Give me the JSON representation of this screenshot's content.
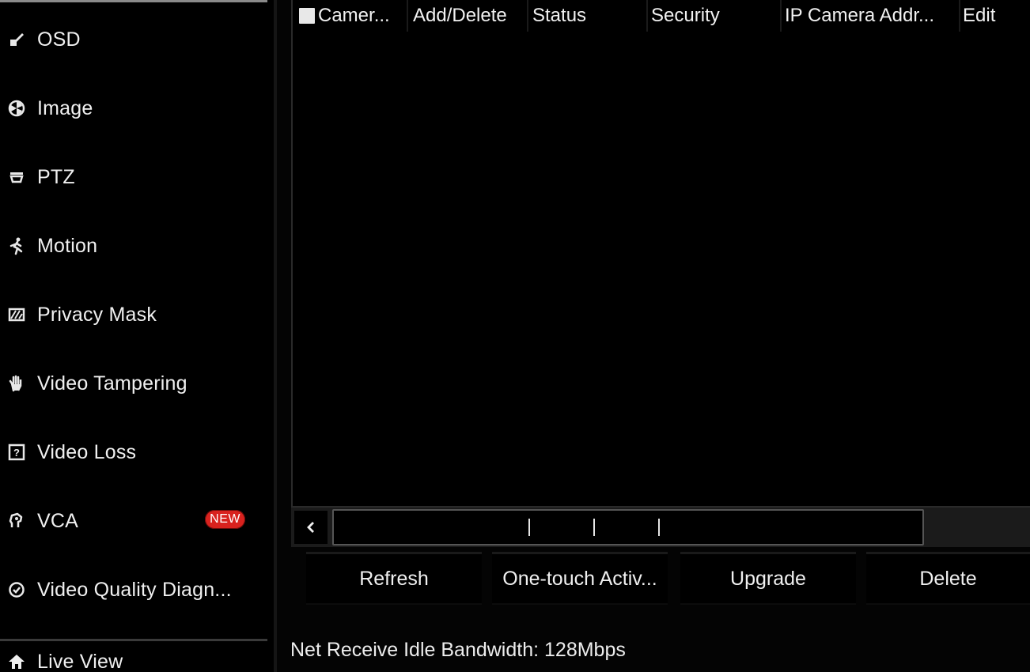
{
  "sidebar": {
    "items": [
      {
        "label": "OSD",
        "icon": "osd-icon"
      },
      {
        "label": "Image",
        "icon": "image-icon"
      },
      {
        "label": "PTZ",
        "icon": "ptz-icon"
      },
      {
        "label": "Motion",
        "icon": "motion-icon"
      },
      {
        "label": "Privacy Mask",
        "icon": "privacy-mask-icon"
      },
      {
        "label": "Video Tampering",
        "icon": "video-tampering-icon"
      },
      {
        "label": "Video Loss",
        "icon": "video-loss-icon"
      },
      {
        "label": "VCA",
        "icon": "vca-icon",
        "badge": "NEW"
      },
      {
        "label": "Video Quality Diagn...",
        "icon": "video-quality-icon"
      }
    ],
    "live_view": {
      "label": "Live View",
      "icon": "home-icon"
    }
  },
  "table": {
    "columns": [
      "Camer...",
      "Add/Delete",
      "Status",
      "Security",
      "IP Camera Addr...",
      "Edit"
    ],
    "rows": []
  },
  "buttons": {
    "refresh": "Refresh",
    "one_touch": "One-touch Activ...",
    "upgrade": "Upgrade",
    "delete": "Delete"
  },
  "status": {
    "bandwidth": "Net Receive Idle Bandwidth: 128Mbps"
  },
  "colors": {
    "background": "#000000",
    "text": "#f0f0f0",
    "badge": "#d8221e"
  }
}
